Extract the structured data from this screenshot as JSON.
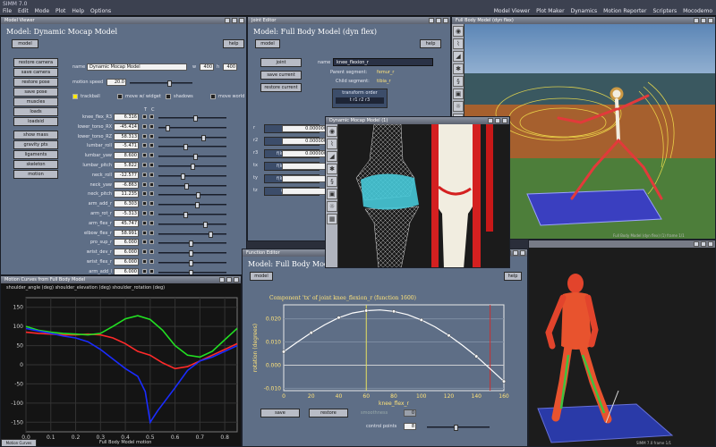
{
  "app": {
    "title": "SIMM 7.0",
    "menu_left": [
      "File",
      "Edit",
      "Mode",
      "Plot",
      "Help",
      "Options"
    ],
    "menu_right": [
      "Model Viewer",
      "Plot Maker",
      "Dynamics",
      "Motion Reporter",
      "Scripters",
      "Mocodemo"
    ]
  },
  "model_viewer": {
    "window_title": "Model Viewer",
    "heading": "Model: Dynamic Mocap Model",
    "model_btn": "model",
    "help_btn": "help",
    "left_buttons": [
      "restore camera",
      "save camera",
      "restore pose",
      "save pose",
      "muscles",
      "loads",
      "loadsid",
      "show mass",
      "gravity pts",
      "ligaments",
      "skeleton",
      "motion"
    ],
    "name_label": "name",
    "name_value": "Dynamic Mocap Model",
    "w_label": "w",
    "w_value": "400",
    "h_label": "h",
    "h_value": "400",
    "motion_speed_label": "motion speed",
    "motion_speed_value": "20.0",
    "check_labels": [
      "trackball",
      "move w/ widget",
      "shadows",
      "move world"
    ],
    "coord_names": [
      "knee_flex_R3",
      "lower_torso_RX",
      "lower_torso_RZ",
      "lumbar_roll",
      "lumbar_yaw",
      "lumbar_pitch",
      "neck_roll",
      "neck_yaw",
      "neck_pitch",
      "arm_add_r",
      "arm_rot_r",
      "arm_flex_r",
      "elbow_flex_r",
      "pro_sup_r",
      "wrist_dev_r",
      "wrist_flex_r",
      "arm_add_l"
    ],
    "coord_values": [
      "6.316",
      "-45.414",
      "58.313",
      "-5.471",
      "8.600",
      "5.822",
      "-12.577",
      "-6.863",
      "11.235",
      "6.303",
      "-5.313",
      "45.747",
      "58.991",
      "6.000",
      "6.000",
      "6.000",
      "6.000"
    ],
    "coord_fractions": [
      0.55,
      0.12,
      0.68,
      0.4,
      0.56,
      0.52,
      0.35,
      0.42,
      0.6,
      0.58,
      0.4,
      0.72,
      0.8,
      0.48,
      0.48,
      0.48,
      0.48
    ],
    "coord_header_a": "T",
    "coord_header_b": "C"
  },
  "joint_editor": {
    "window_title": "Joint Editor",
    "heading": "Model: Full Body Model (dyn flex)",
    "model_btn": "model",
    "help_btn": "help",
    "joint_btn": "joint",
    "save_btn": "save current",
    "restore_btn": "restore current",
    "name_label": "name",
    "name_value": "knee_flexion_r",
    "parent_label": "Parent segment:",
    "parent_value": "femur_r",
    "child_label": "Child segment:",
    "child_value": "tibia_r",
    "order_label": "transform order",
    "order_value": "t r1 r2 r3",
    "dof_labels": [
      "r",
      "r2",
      "r3",
      "tx",
      "ty",
      "tz"
    ],
    "dof_values": [
      "0.000000",
      "0.000000",
      "0.000000",
      "",
      "",
      ""
    ],
    "dof_funcs": [
      "",
      "",
      "f(knee_flex_r)",
      "f(knee_flex_r)",
      "f(knee_flex_r)",
      "0.000000"
    ]
  },
  "mocap_view": {
    "window_title": "Dynamic Mocap Model (1)"
  },
  "body_view_top": {
    "window_title": "Full Body Model (dyn flex)",
    "footer": "Full Body Model (dyn flex) (1)   frame 1/1"
  },
  "body_view_bottom": {
    "footer": "SIMM 7.0   frame 1/1"
  },
  "motion_curves": {
    "window_title": "Motion Curves from Full Body Model",
    "legend": "shoulder_angle (deg)  shoulder_elevation (deg)  shoulder_rotation (deg)",
    "xlabel": "Full Body Model motion",
    "footer_tab": "Motion Curves"
  },
  "function_editor": {
    "window_title": "Function Editor",
    "heading": "Model: Full Body Model (dyn flex)",
    "model_btn": "model",
    "help_btn": "help",
    "save_btn": "save",
    "restore_btn": "restore",
    "smooth_label": "smoothness",
    "smooth_value": "0",
    "cp_label": "control points",
    "cp_value": "8"
  },
  "chart_data": [
    {
      "type": "line",
      "title": "",
      "xlabel": "",
      "ylabel": "",
      "x_ticks": [
        "0.0",
        "0.1",
        "0.2",
        "0.3",
        "0.4",
        "0.5",
        "0.6",
        "0.7",
        "0.8"
      ],
      "y_ticks": [
        "150",
        "100",
        "50",
        "0",
        "-50",
        "-100",
        "-150"
      ],
      "xlim": [
        0,
        0.85
      ],
      "ylim": [
        -175,
        175
      ],
      "grid": true,
      "series": [
        {
          "color": "#ff2a2a",
          "x": [
            0,
            0.05,
            0.1,
            0.15,
            0.2,
            0.25,
            0.3,
            0.35,
            0.4,
            0.45,
            0.5,
            0.55,
            0.6,
            0.65,
            0.7,
            0.75,
            0.8,
            0.85
          ],
          "y": [
            85,
            82,
            80,
            78,
            78,
            80,
            78,
            70,
            55,
            35,
            25,
            5,
            -10,
            -5,
            10,
            25,
            40,
            55
          ]
        },
        {
          "color": "#22e022",
          "x": [
            0,
            0.05,
            0.1,
            0.15,
            0.2,
            0.25,
            0.3,
            0.35,
            0.4,
            0.45,
            0.5,
            0.55,
            0.6,
            0.65,
            0.7,
            0.75,
            0.8,
            0.85
          ],
          "y": [
            100,
            90,
            85,
            82,
            80,
            78,
            82,
            100,
            120,
            128,
            118,
            90,
            50,
            25,
            20,
            35,
            65,
            95
          ]
        },
        {
          "color": "#1a2cff",
          "x": [
            0,
            0.05,
            0.1,
            0.15,
            0.2,
            0.25,
            0.3,
            0.35,
            0.4,
            0.45,
            0.48,
            0.5,
            0.53,
            0.6,
            0.65,
            0.7,
            0.75,
            0.8,
            0.85
          ],
          "y": [
            95,
            88,
            82,
            75,
            70,
            60,
            40,
            15,
            -10,
            -30,
            -70,
            -150,
            -120,
            -60,
            -15,
            10,
            20,
            35,
            50
          ]
        }
      ]
    },
    {
      "type": "line",
      "title": "Component 'tx' of joint knee_flexion_r (function 1600)",
      "xlabel": "knee_flex_r",
      "ylabel": "rotation (degrees)",
      "x_ticks": [
        "0",
        "20",
        "40",
        "60",
        "80",
        "100",
        "120",
        "140",
        "160"
      ],
      "y_ticks": [
        "0.020",
        "0.010",
        "0.000",
        "-0.010"
      ],
      "xlim": [
        0,
        160
      ],
      "ylim": [
        -0.011,
        0.026
      ],
      "grid": true,
      "series": [
        {
          "color": "#ffffff",
          "x": [
            0,
            10,
            20,
            30,
            40,
            50,
            60,
            70,
            80,
            90,
            100,
            110,
            120,
            130,
            140,
            150,
            160
          ],
          "y": [
            0.0058,
            0.01,
            0.014,
            0.0175,
            0.0205,
            0.0225,
            0.0235,
            0.0238,
            0.0232,
            0.0218,
            0.0195,
            0.0165,
            0.0128,
            0.0085,
            0.0038,
            -0.0015,
            -0.007
          ]
        }
      ],
      "control_points": {
        "x": [
          0,
          20,
          40,
          60,
          80,
          100,
          120,
          140,
          160
        ],
        "y": [
          0.0058,
          0.014,
          0.0205,
          0.0235,
          0.0232,
          0.0195,
          0.0128,
          0.0038,
          -0.007
        ]
      }
    }
  ]
}
